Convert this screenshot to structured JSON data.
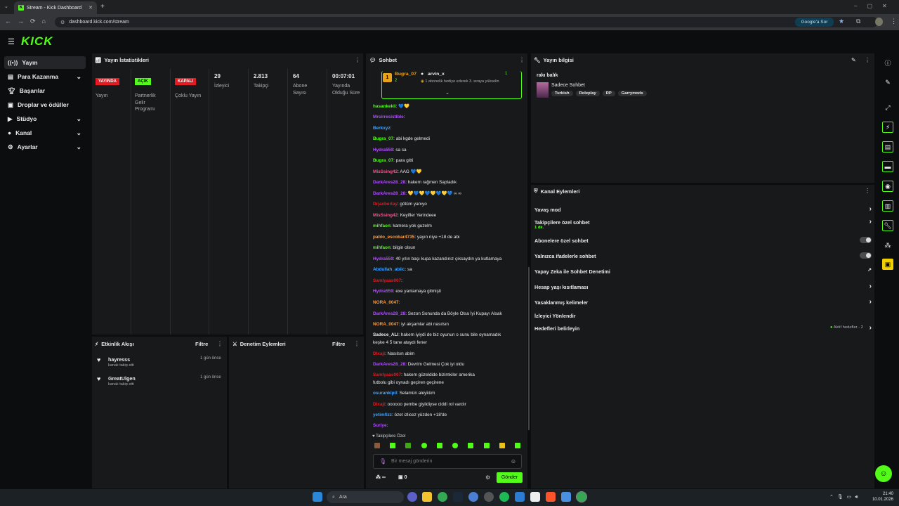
{
  "browser": {
    "tab_title": "Stream - Kick Dashboard",
    "url": "dashboard.kick.com/stream",
    "google_label": "Google'a Sor"
  },
  "brand": {
    "logo": "KICK",
    "accent": "#53fc18"
  },
  "sidebar": {
    "items": [
      {
        "label": "Yayın"
      },
      {
        "label": "Para Kazanma"
      },
      {
        "label": "Başarılar"
      },
      {
        "label": "Droplar ve ödüller"
      },
      {
        "label": "Stüdyo"
      },
      {
        "label": "Kanal"
      },
      {
        "label": "Ayarlar"
      }
    ]
  },
  "stats": {
    "title": "Yayın İstatistikleri",
    "items": [
      {
        "badge": "YAYINDA",
        "label": "Yayın"
      },
      {
        "badge": "AÇIK",
        "label": "Partnerlik Gelir Programı"
      },
      {
        "badge": "KAPALI",
        "label": "Çoklu Yayın"
      },
      {
        "value": "29",
        "label": "İzleyici"
      },
      {
        "value": "2.813",
        "label": "Takipçi"
      },
      {
        "value": "64",
        "label": "Abone Sayısı"
      },
      {
        "value": "00:07:01",
        "label": "Yayında Olduğu Süre"
      }
    ]
  },
  "activity": {
    "title": "Etkinlik Akışı",
    "filter": "Filtre",
    "items": [
      {
        "user": "hayresss",
        "action": "kanalı takip etti",
        "time": "1 gün önce"
      },
      {
        "user": "GreatUlgen",
        "action": "kanalı takip etti",
        "time": "1 gün önce"
      }
    ]
  },
  "moderation": {
    "title": "Denetim Eylemleri",
    "filter": "Filtre"
  },
  "chat": {
    "title": "Sohbet",
    "pinned": {
      "rank": "1",
      "user1": "Bugra_07",
      "count1": "2",
      "user2": "arvin_x",
      "count2": "1",
      "note": "1 abonelik hediye ederek 3. sıraya yükselin"
    },
    "messages": [
      {
        "user": "hasankekli",
        "text": ": 💙💛"
      },
      {
        "user": "Mrsirresistible",
        "text": ":"
      },
      {
        "user": "Berkxyz",
        "text": ":"
      },
      {
        "user": "Bugra_07",
        "text": ": abi kgde gelmedi"
      },
      {
        "user": "Hydra559",
        "text": ": sa sa"
      },
      {
        "user": "Bugra_07",
        "text": ": para gitti"
      },
      {
        "user": "MisSsing42",
        "text": ": AAG 💙💛"
      },
      {
        "user": "DarkAres28_28",
        "text": ": hakem rağmen Sapladık"
      },
      {
        "user": "DarkAres28_28",
        "text": ": 💛💙💛💙💛💙💛💙 ∞ ∞"
      },
      {
        "user": "Drjaxberlay",
        "text": ": götüm yanıyo"
      },
      {
        "user": "MisSsing42",
        "text": ": Keyifler Yerindeee"
      },
      {
        "user": "mihfaon",
        "text": ": kamera yok guzelm"
      },
      {
        "user": "pablo_escobar4735",
        "text": ": yayın niye +18 de abi"
      },
      {
        "user": "mihfaon",
        "text": ": bilgin olsun"
      },
      {
        "user": "Hydra559",
        "text": ": 40 yılın başı kupa kazandınız çıksaydın ya kutlamaya"
      },
      {
        "user": "Abdullah_abiic",
        "text": ": sa"
      },
      {
        "user": "Samlyaas007",
        "text": ":"
      },
      {
        "user": "Hydra559",
        "text": ": exe yanlamaya gitmişti"
      },
      {
        "user": "NORA_0047",
        "text": ":"
      },
      {
        "user": "DarkAres28_28",
        "text": ": Sezon Sonunda da Böyle Olsa İyi Kupayı Alsak"
      },
      {
        "user": "NORA_0047",
        "text": ": iyi akşamlar abi nasılsın"
      },
      {
        "user": "Sadece_ALI",
        "text": ": hakem iyiydi de biz oyunun o sunu bile oynamadık"
      },
      {
        "user": "",
        "text": "keşke 4 5 tane ataydı fener"
      },
      {
        "user": "Dlxaji",
        "text": ": Nasılsın abim"
      },
      {
        "user": "DarkAres28_28",
        "text": ": Devrim Gelmesi Çok iyi oldu"
      },
      {
        "user": "Samlyaas007",
        "text": ": hakem güzeldide bizimkiler amerika"
      },
      {
        "user": "",
        "text": "futbolu gibi oynadı geçiren geçirene"
      },
      {
        "user": "osurankipil",
        "text": ": Selamün aleyküm"
      },
      {
        "user": "Dlxaji",
        "text": ": oooooo pembe giyildiyse ciddi rol vardır"
      },
      {
        "user": "yetimfizz",
        "text": ": özet izlicez yüzden +18'de"
      },
      {
        "user": "Suriye",
        "text": ":"
      }
    ],
    "followers_only": "Takipçilere Özel",
    "input_placeholder": "Bir mesaj gönderin",
    "count_infinity": "∞",
    "count_zero": "0",
    "send_label": "Gönder"
  },
  "stream_info": {
    "title": "Yayın bilgisi",
    "stream_title": "rakı balık",
    "category": "Sadece Sohbet",
    "tags": [
      "Turkish",
      "Roleplay",
      "RP",
      "Garrymods"
    ]
  },
  "channel_actions": {
    "title": "Kanal Eylemleri",
    "items": [
      {
        "label": "Yavaş mod",
        "kind": "chev"
      },
      {
        "label": "Takipçilere özel sohbet",
        "sub": "1 dk.",
        "kind": "chev"
      },
      {
        "label": "Abonelere özel sohbet",
        "kind": "toggle"
      },
      {
        "label": "Yalnızca ifadelerle sohbet",
        "kind": "toggle"
      },
      {
        "label": "Yapay Zeka ile Sohbet Denetimi",
        "kind": "ext"
      },
      {
        "label": "Hesap yaşı kısıtlaması",
        "kind": "chev"
      },
      {
        "label": "Yasaklanmış kelimeler",
        "kind": "chev"
      },
      {
        "label": "İzleyici Yönlendir",
        "kind": "none"
      },
      {
        "label": "Hedefleri belirleyin",
        "kind": "chev",
        "status": "Aktif hedefler - 2"
      }
    ]
  },
  "taskbar": {
    "search": "Ara",
    "time": "21:40",
    "date": "10.01.2026"
  }
}
